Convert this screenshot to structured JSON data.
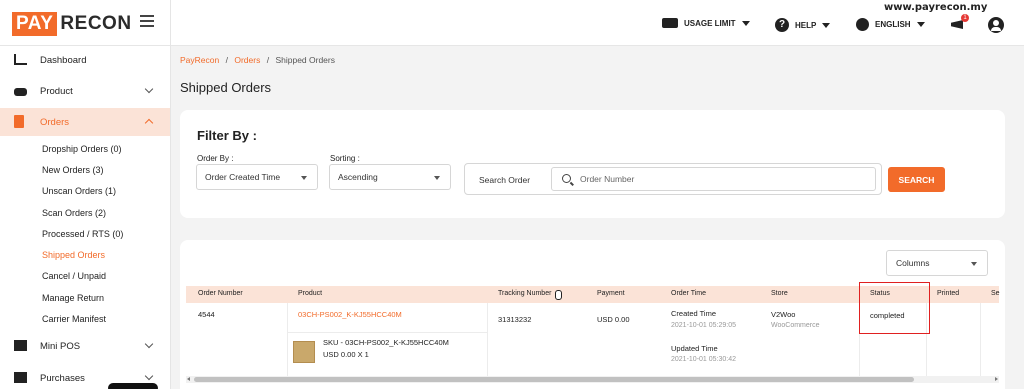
{
  "topbar": {
    "logo_pay": "PAY",
    "logo_recon": "RECON",
    "usage_limit": "USAGE LIMIT",
    "help": "HELP",
    "language": "ENGLISH",
    "notification_count": "1",
    "watermark_url": "www.payrecon.my"
  },
  "sidebar": {
    "items": [
      {
        "label": "Dashboard"
      },
      {
        "label": "Product"
      },
      {
        "label": "Orders"
      },
      {
        "label": "Mini POS"
      },
      {
        "label": "Purchases"
      }
    ],
    "order_subitems": [
      "Dropship Orders (0)",
      "New Orders (3)",
      "Unscan Orders (1)",
      "Scan Orders (2)",
      "Processed / RTS (0)",
      "Shipped Orders",
      "Cancel / Unpaid",
      "Manage Return",
      "Carrier Manifest"
    ]
  },
  "breadcrumb": {
    "home": "PayRecon",
    "orders": "Orders",
    "current": "Shipped Orders",
    "sep": "/"
  },
  "page_title": "Shipped Orders",
  "filter": {
    "title": "Filter By :",
    "order_by_label": "Order By :",
    "order_by_value": "Order Created Time",
    "sorting_label": "Sorting :",
    "sorting_value": "Ascending",
    "search_label": "Search Order",
    "search_placeholder": "Order Number",
    "search_button": "SEARCH"
  },
  "table": {
    "columns_button": "Columns",
    "headers": [
      "Order Number",
      "Product",
      "Tracking Number",
      "Payment",
      "Order Time",
      "Store",
      "Status",
      "Printed",
      "Se"
    ],
    "rows": [
      {
        "order_number": "4544",
        "product_name": "03CH-PS002_K-KJ55HCC40M",
        "sku": "SKU - 03CH-PS002_K-KJ55HCC40M",
        "price_qty": "USD 0.00 X 1",
        "tracking_number": "31313232",
        "payment": "USD 0.00",
        "created_label": "Created Time",
        "created_time": "2021-10-01 05:29:05",
        "updated_label": "Updated Time",
        "updated_time": "2021-10-01 05:30:42",
        "store": "V2Woo",
        "store_platform": "WooCommerce",
        "status": "completed"
      }
    ]
  }
}
